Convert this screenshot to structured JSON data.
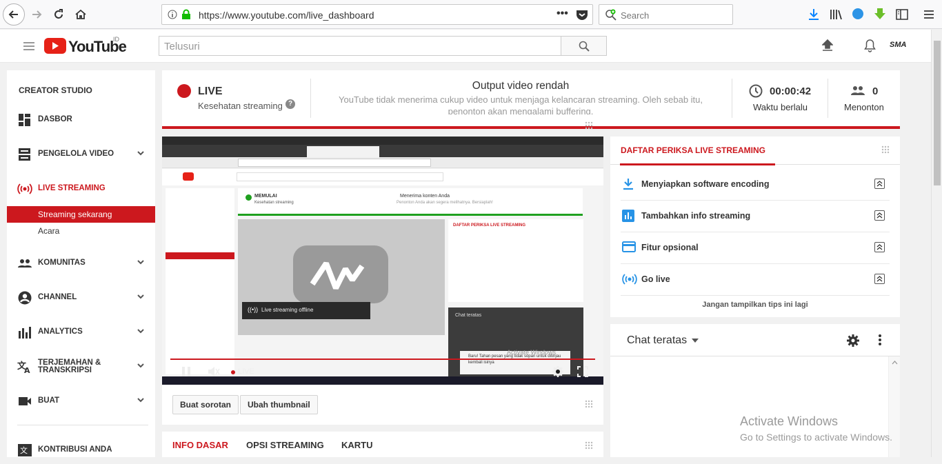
{
  "browser": {
    "url": "https://www.youtube.com/live_dashboard",
    "search_placeholder": "Search"
  },
  "yt": {
    "logo_text": "YouTube",
    "region": "ID",
    "search_placeholder": "Telusuri",
    "avatar_text": "SMA"
  },
  "sidebar": {
    "title": "CREATOR STUDIO",
    "items": [
      {
        "label": "DASBOR"
      },
      {
        "label": "PENGELOLA VIDEO"
      },
      {
        "label": "LIVE STREAMING"
      },
      {
        "label": "KOMUNITAS"
      },
      {
        "label": "CHANNEL"
      },
      {
        "label": "ANALYTICS"
      },
      {
        "label": "TERJEMAHAN & TRANSKRIPSI"
      },
      {
        "label": "BUAT"
      },
      {
        "label": "KONTRIBUSI ANDA"
      }
    ],
    "sub_items": [
      {
        "label": "Streaming sekarang"
      },
      {
        "label": "Acara"
      }
    ]
  },
  "status": {
    "live_label": "LIVE",
    "health_label": "Kesehatan streaming",
    "output_title": "Output video rendah",
    "output_desc": "YouTube tidak menerima cukup video untuk menjaga kelancaran streaming. Oleh sebab itu, penonton akan mengalami buffering.",
    "elapsed_value": "00:00:42",
    "elapsed_label": "Waktu berlalu",
    "viewers_value": "0",
    "viewers_label": "Menonton"
  },
  "video": {
    "offline_text": "Live streaming offline",
    "live_badge": "LIVE",
    "inner_status": "MEMULAI",
    "inner_health": "Kesehatan streaming",
    "inner_output_title": "Menerima konten Anda",
    "inner_output_desc": "Penonton Anda akan segera melihatnya. Bersiaplah!",
    "inner_check_title": "DAFTAR PERIKSA LIVE STREAMING",
    "inner_chat": "Chat teratas",
    "inner_chat_msg": "Baru! Tahan pesan yang tidak sopan untuk ditinjau kembali isinya",
    "watermark": "Activate Windows"
  },
  "below": {
    "highlight_btn": "Buat sorotan",
    "thumbnail_btn": "Ubah thumbnail"
  },
  "tabs": [
    {
      "label": "INFO DASAR"
    },
    {
      "label": "OPSI STREAMING"
    },
    {
      "label": "KARTU"
    }
  ],
  "checklist": {
    "title": "DAFTAR PERIKSA LIVE STREAMING",
    "items": [
      {
        "label": "Menyiapkan software encoding"
      },
      {
        "label": "Tambahkan info streaming"
      },
      {
        "label": "Fitur opsional"
      },
      {
        "label": "Go live"
      }
    ],
    "hide_tips": "Jangan tampilkan tips ini lagi"
  },
  "chat": {
    "title": "Chat teratas"
  },
  "windows": {
    "line1": "Activate Windows",
    "line2": "Go to Settings to activate Windows."
  },
  "colors": {
    "accent": "#cc181e",
    "blue": "#2793e6"
  }
}
